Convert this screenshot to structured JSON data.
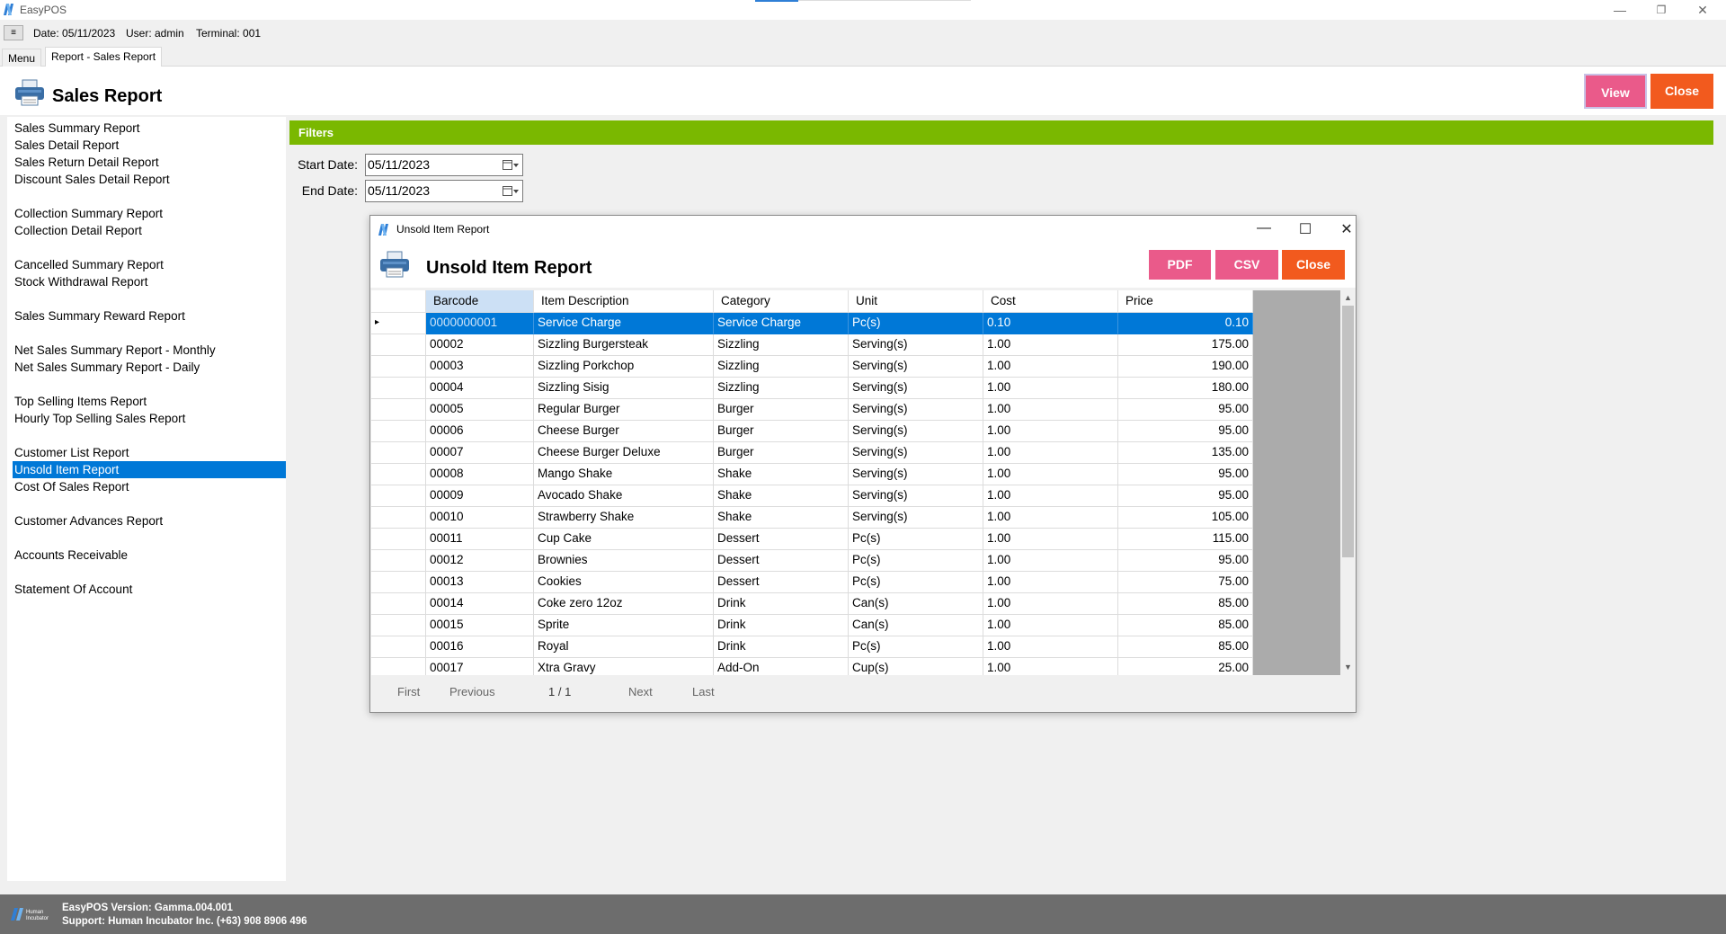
{
  "app": {
    "title": "EasyPOS",
    "brand_blue": "#2f7fd6"
  },
  "window_controls": {
    "minimize": "—",
    "restore": "❐",
    "close": "✕"
  },
  "infobar": {
    "menu_toggle": "≡",
    "date": "Date: 05/11/2023",
    "user": "User: admin",
    "terminal": "Terminal: 001"
  },
  "tabs": [
    {
      "label": "Menu"
    },
    {
      "label": "Report - Sales Report"
    }
  ],
  "header": {
    "title": "Sales Report",
    "view_label": "View",
    "close_label": "Close",
    "view_color": "#ea5a8a",
    "close_color": "#f25a1e"
  },
  "sidebar": {
    "items": [
      {
        "label": "Sales Summary Report"
      },
      {
        "label": "Sales Detail Report"
      },
      {
        "label": "Sales Return Detail Report"
      },
      {
        "label": "Discount Sales Detail Report"
      },
      {
        "label": "Collection Summary Report"
      },
      {
        "label": "Collection Detail Report"
      },
      {
        "label": "Cancelled Summary Report"
      },
      {
        "label": "Stock Withdrawal Report"
      },
      {
        "label": "Sales Summary Reward Report"
      },
      {
        "label": "Net Sales Summary Report - Monthly"
      },
      {
        "label": "Net Sales Summary Report - Daily"
      },
      {
        "label": "Top Selling Items Report"
      },
      {
        "label": "Hourly Top Selling Sales Report"
      },
      {
        "label": "Customer List Report"
      },
      {
        "label": "Unsold Item Report"
      },
      {
        "label": "Cost Of Sales Report"
      },
      {
        "label": "Customer Advances Report"
      },
      {
        "label": "Accounts Receivable"
      },
      {
        "label": "Statement Of Account"
      }
    ],
    "selected_index": 14
  },
  "filters": {
    "title": "Filters",
    "start_label": "Start Date:",
    "start_value": "05/11/2023",
    "end_label": "End Date:",
    "end_value": "05/11/2023",
    "bar_color": "#7ab800"
  },
  "modal": {
    "window_title": "Unsold Item Report",
    "title": "Unsold Item Report",
    "pdf_label": "PDF",
    "csv_label": "CSV",
    "close_label": "Close",
    "controls": {
      "minimize": "—",
      "maximize": "☐",
      "close": "✕"
    },
    "columns": [
      "Barcode",
      "Item Description",
      "Category",
      "Unit",
      "Cost",
      "Price"
    ],
    "rows": [
      [
        "0000000001",
        "Service Charge",
        "Service Charge",
        "Pc(s)",
        "0.10",
        "0.10"
      ],
      [
        "00002",
        "Sizzling Burgersteak",
        "Sizzling",
        "Serving(s)",
        "1.00",
        "175.00"
      ],
      [
        "00003",
        "Sizzling Porkchop",
        "Sizzling",
        "Serving(s)",
        "1.00",
        "190.00"
      ],
      [
        "00004",
        "Sizzling  Sisig",
        "Sizzling",
        "Serving(s)",
        "1.00",
        "180.00"
      ],
      [
        "00005",
        "Regular Burger",
        "Burger",
        "Serving(s)",
        "1.00",
        "95.00"
      ],
      [
        "00006",
        "Cheese Burger",
        "Burger",
        "Serving(s)",
        "1.00",
        "95.00"
      ],
      [
        "00007",
        "Cheese Burger Deluxe",
        "Burger",
        "Serving(s)",
        "1.00",
        "135.00"
      ],
      [
        "00008",
        "Mango Shake",
        "Shake",
        "Serving(s)",
        "1.00",
        "95.00"
      ],
      [
        "00009",
        "Avocado Shake",
        "Shake",
        "Serving(s)",
        "1.00",
        "95.00"
      ],
      [
        "00010",
        "Strawberry Shake",
        "Shake",
        "Serving(s)",
        "1.00",
        "105.00"
      ],
      [
        "00011",
        "Cup Cake",
        "Dessert",
        "Pc(s)",
        "1.00",
        "115.00"
      ],
      [
        "00012",
        "Brownies",
        "Dessert",
        "Pc(s)",
        "1.00",
        "95.00"
      ],
      [
        "00013",
        "Cookies",
        "Dessert",
        "Pc(s)",
        "1.00",
        "75.00"
      ],
      [
        "00014",
        "Coke zero 12oz",
        "Drink",
        "Can(s)",
        "1.00",
        "85.00"
      ],
      [
        "00015",
        "Sprite",
        "Drink",
        "Can(s)",
        "1.00",
        "85.00"
      ],
      [
        "00016",
        "Royal",
        "Drink",
        "Pc(s)",
        "1.00",
        "85.00"
      ],
      [
        "00017",
        "Xtra Gravy",
        "Add-On",
        "Cup(s)",
        "1.00",
        "25.00"
      ]
    ],
    "selected_row": 0,
    "row_marker": "▸",
    "pager": {
      "first": "First",
      "previous": "Previous",
      "page": "1 / 1",
      "next": "Next",
      "last": "Last"
    }
  },
  "footer": {
    "version": "EasyPOS Version: Gamma.004.001",
    "support": "Support: Human Incubator Inc. (+63) 908 8906 496",
    "logo_text": "Human Incubator"
  }
}
